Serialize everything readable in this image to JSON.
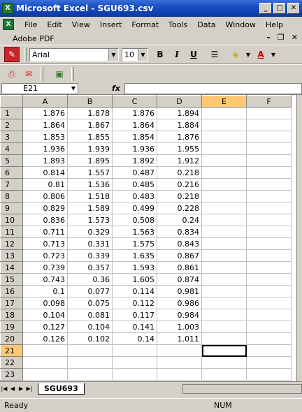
{
  "window": {
    "title": "Microsoft Excel - SGU693.csv",
    "app_icon": "X"
  },
  "menu": {
    "items": [
      {
        "label": "File"
      },
      {
        "label": "Edit"
      },
      {
        "label": "View"
      },
      {
        "label": "Insert"
      },
      {
        "label": "Format"
      },
      {
        "label": "Tools"
      },
      {
        "label": "Data"
      },
      {
        "label": "Window"
      },
      {
        "label": "Help"
      }
    ],
    "row2": "Adobe PDF"
  },
  "toolbar": {
    "font_name": "Arial",
    "font_size": "10",
    "bold": "B",
    "italic": "I",
    "underline": "U",
    "font_color": "A"
  },
  "formula_bar": {
    "name_box": "E21",
    "fx_label": "fx",
    "content": ""
  },
  "sheet": {
    "columns": [
      "A",
      "B",
      "C",
      "D",
      "E",
      "F"
    ],
    "active_cell": "E21",
    "rows": [
      [
        "1.876",
        "1.878",
        "1.876",
        "1.894"
      ],
      [
        "1.864",
        "1.867",
        "1.864",
        "1.884"
      ],
      [
        "1.853",
        "1.855",
        "1.854",
        "1.876"
      ],
      [
        "1.936",
        "1.939",
        "1.936",
        "1.955"
      ],
      [
        "1.893",
        "1.895",
        "1.892",
        "1.912"
      ],
      [
        "0.814",
        "1.557",
        "0.487",
        "0.218"
      ],
      [
        "0.81",
        "1.536",
        "0.485",
        "0.216"
      ],
      [
        "0.806",
        "1.518",
        "0.483",
        "0.218"
      ],
      [
        "0.829",
        "1.589",
        "0.499",
        "0.228"
      ],
      [
        "0.836",
        "1.573",
        "0.508",
        "0.24"
      ],
      [
        "0.711",
        "0.329",
        "1.563",
        "0.834"
      ],
      [
        "0.713",
        "0.331",
        "1.575",
        "0.843"
      ],
      [
        "0.723",
        "0.339",
        "1.635",
        "0.867"
      ],
      [
        "0.739",
        "0.357",
        "1.593",
        "0.861"
      ],
      [
        "0.743",
        "0.36",
        "1.605",
        "0.874"
      ],
      [
        "0.1",
        "0.077",
        "0.114",
        "0.981"
      ],
      [
        "0.098",
        "0.075",
        "0.112",
        "0.986"
      ],
      [
        "0.104",
        "0.081",
        "0.117",
        "0.984"
      ],
      [
        "0.127",
        "0.104",
        "0.141",
        "1.003"
      ],
      [
        "0.126",
        "0.102",
        "0.14",
        "1.011"
      ],
      [
        "",
        "",
        "",
        ""
      ],
      [
        "",
        "",
        "",
        ""
      ],
      [
        "",
        "",
        "",
        ""
      ]
    ]
  },
  "tabs": {
    "sheet_name": "SGU693"
  },
  "status": {
    "mode": "Ready",
    "num_lock": "NUM"
  },
  "colors": {
    "titlebar": "#0c3aa8",
    "selected_header": "#ffc875",
    "chrome": "#d4d0c8"
  }
}
